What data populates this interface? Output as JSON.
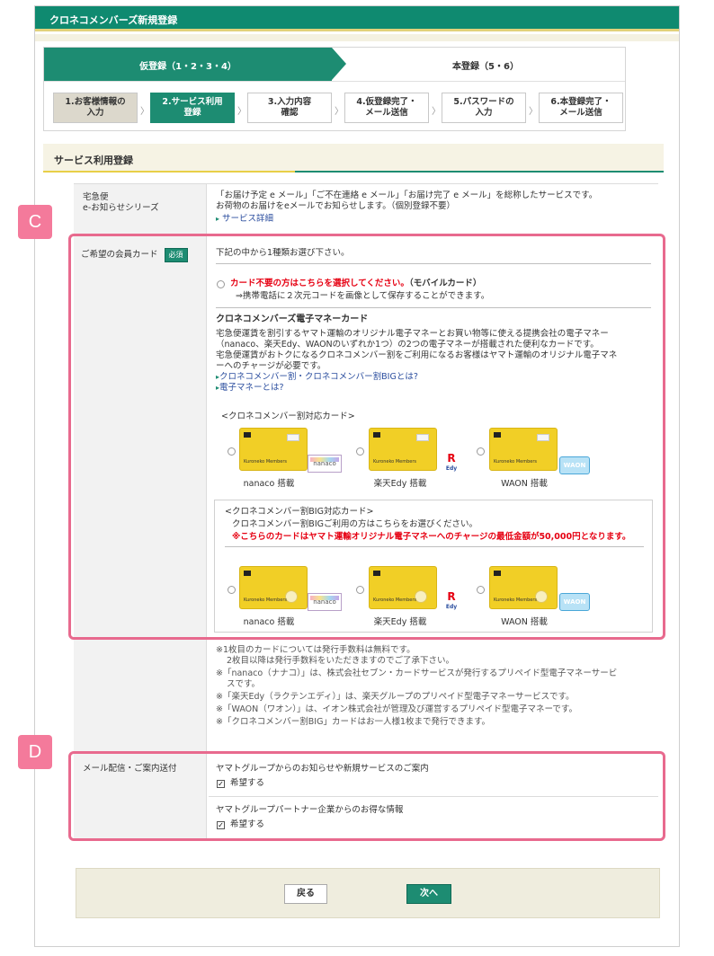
{
  "header": {
    "title": "クロネコメンバーズ新規登録"
  },
  "progress": {
    "phase1": "仮登録（1・2・3・4）",
    "phase2": "本登録（5・6）",
    "steps": [
      {
        "line1": "1.お客様情報の",
        "line2": "入力"
      },
      {
        "line1": "2.サービス利用",
        "line2": "登録"
      },
      {
        "line1": "3.入力内容",
        "line2": "確認"
      },
      {
        "line1": "4.仮登録完了・",
        "line2": "メール送信"
      },
      {
        "line1": "5.パスワードの",
        "line2": "入力"
      },
      {
        "line1": "6.本登録完了・",
        "line2": "メール送信"
      }
    ],
    "separator": "〉"
  },
  "section": {
    "title": "サービス利用登録"
  },
  "row_notice": {
    "label1": "宅急便",
    "label2": "e-お知らせシリーズ",
    "text1": "「お届け予定 e メール」「ご不在連絡 e メール」「お届け完了 e メール」を総称したサービスです。",
    "text2": "お荷物のお届けをeメールでお知らせします。（個別登録不要）",
    "link": "サービス詳細"
  },
  "row_card": {
    "label": "ご希望の会員カード",
    "required": "必須",
    "intro": "下記の中から1種類お選び下さい。",
    "mobile_red": "カード不要の方はこちらを選択してください。",
    "mobile_tail": "（モバイルカード）",
    "mobile_sub": "⇒携帯電話に２次元コードを画像として保存することができます。",
    "emoney_title": "クロネコメンバーズ電子マネーカード",
    "emoney_desc1": "宅急便運賃を割引するヤマト運輸のオリジナル電子マネーとお買い物等に使える提携会社の電子マネー",
    "emoney_desc2": "（nanaco、楽天Edy、WAONのいずれか1つ）の2つの電子マネーが搭載された便利なカードです。",
    "emoney_desc3": "宅急便運賃がおトクになるクロネコメンバー割をご利用になるお客様はヤマト運輸のオリジナル電子マネ",
    "emoney_desc4": "ーへのチャージが必要です。",
    "link1": "クロネコメンバー割・クロネコメンバー割BIGとは?",
    "link2": "電子マネーとは?",
    "group1_title": "<クロネコメンバー割対応カード>",
    "group2_title": "<クロネコメンバー割BIG対応カード>",
    "group2_sub": "クロネコメンバー割BIGご利用の方はこちらをお選びください。",
    "group2_warn": "※こちらのカードはヤマト運輸オリジナル電子マネーへのチャージの最低金額が50,000円となります。",
    "cards": [
      "nanaco 搭載",
      "楽天Edy 搭載",
      "WAON 搭載"
    ],
    "card_name": "Kuroneko Members",
    "badge_nanaco": "nanaco",
    "badge_edy": "R",
    "badge_edy_sub": "Edy",
    "badge_waon": "WAON"
  },
  "notes": [
    "※1枚目のカードについては発行手数料は無料です。",
    "2枚目以降は発行手数料をいただきますのでご了承下さい。",
    "※「nanaco（ナナコ）」は、株式会社セブン・カードサービスが発行するプリペイド型電子マネーサービ",
    "スです。",
    "※「楽天Edy（ラクテンエディ）」は、楽天グループのプリペイド型電子マネーサービスです。",
    "※「WAON（ワオン）」は、イオン株式会社が管理及び運営するプリペイド型電子マネーです。",
    "※「クロネコメンバー割BIG」カードはお一人様1枚まで発行できます。"
  ],
  "row_mail": {
    "label": "メール配信・ご案内送付",
    "item1": "ヤマトグループからのお知らせや新規サービスのご案内",
    "item2": "ヤマトグループパートナー企業からのお得な情報",
    "check_label": "希望する",
    "check_mark": "✓"
  },
  "markers": {
    "c": "C",
    "d": "D"
  },
  "footer": {
    "back": "戻る",
    "next": "次へ"
  }
}
